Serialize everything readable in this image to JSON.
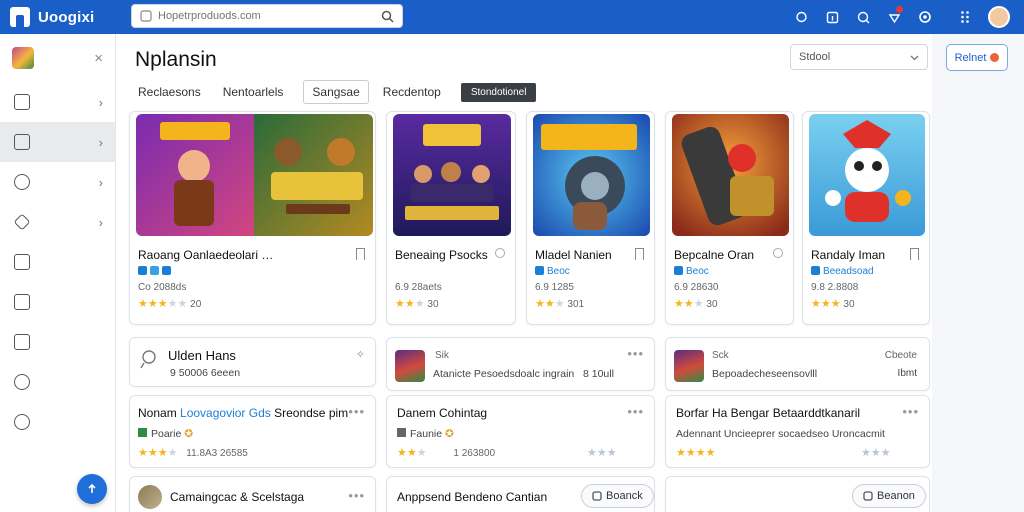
{
  "topbar": {
    "brand": "Uoogixi",
    "search_placeholder": "Hopetrproduods.com"
  },
  "sidebar": {
    "close": "×",
    "arrows": [
      "›",
      "›",
      "›",
      "›"
    ]
  },
  "main": {
    "title": "Nplansin",
    "sort_label": "Stdool",
    "tabs": [
      "Reclaesons",
      "Nentoarlels",
      "Sangsae",
      "Recdentop",
      "Stondotionel"
    ]
  },
  "games": [
    {
      "title": "Raoang Oanlaedeolari …",
      "tag": "",
      "meta": "Co 2088ds",
      "rating": "20",
      "stars": 3
    },
    {
      "title": "Beneaing Psocks",
      "tag": "",
      "meta": "6.9 28aets",
      "rating": "30",
      "stars": 2
    },
    {
      "title": "Mladel Nanien",
      "tag": "Beoc",
      "meta": "6.9 1285",
      "rating": "301",
      "stars": 2
    },
    {
      "title": "Bepcalne Oran",
      "tag": "Beoc",
      "meta": "6.9 28630",
      "rating": "30",
      "stars": 2
    },
    {
      "title": "Randaly Iman",
      "tag": "Beeadsoad",
      "meta": "9.8 2.8808",
      "rating": "30",
      "stars": 3
    }
  ],
  "cards": {
    "c1": {
      "title": "Ulden Hans",
      "sub": "9 50006 6eeen"
    },
    "c2": {
      "badge": "Sik",
      "sub": "Atanicte Pesoedsdoalc ingrain",
      "extra": "8 10ull"
    },
    "c3": {
      "badge": "Sck",
      "right1": "Cbeote",
      "sub": "Bepoadecheseensovlll",
      "right2": "Ibmt"
    },
    "c4": {
      "title_a": "Nonam",
      "title_b": "Loovagovior Gds",
      "title_c": "Sreondse pim",
      "sub": "Poarie",
      "meta": "11.8A3 26585"
    },
    "c5": {
      "title": "Danem Cohintag",
      "sub": "Faunie",
      "meta": "1 263800"
    },
    "c6": {
      "title": "Borfar Ha Bengar Betaarddtkanaril",
      "sub": "Adennant Uncieeprer socaedseo Uroncacmit"
    },
    "c7": {
      "title": "Camaingcac & Scelstaga"
    },
    "c8": {
      "title": "Anppsend Bendeno Cantian",
      "button": "Boanck"
    },
    "c9": {
      "button": "Beanon"
    }
  },
  "rightcol": {
    "button": "Relnet"
  },
  "colors": {
    "primary": "#1a5fc8",
    "accent": "#1c7fd6",
    "star": "#f3b51b"
  }
}
